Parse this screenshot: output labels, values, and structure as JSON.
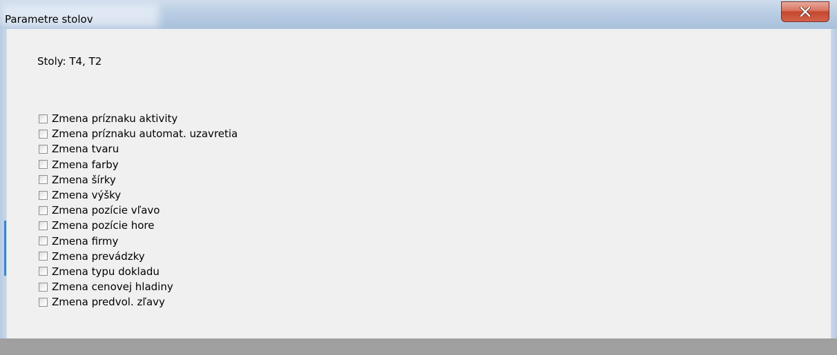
{
  "window": {
    "title": "Parametre stolov"
  },
  "content": {
    "stoly_text": "Stoly: T4, T2"
  },
  "checklist": [
    {
      "label": "Zmena príznaku aktivity",
      "checked": false
    },
    {
      "label": "Zmena príznaku automat. uzavretia",
      "checked": false
    },
    {
      "label": "Zmena tvaru",
      "checked": false
    },
    {
      "label": "Zmena farby",
      "checked": false
    },
    {
      "label": "Zmena šírky",
      "checked": false
    },
    {
      "label": "Zmena výšky",
      "checked": false
    },
    {
      "label": "Zmena pozície vľavo",
      "checked": false
    },
    {
      "label": "Zmena pozície hore",
      "checked": false
    },
    {
      "label": "Zmena firmy",
      "checked": false
    },
    {
      "label": "Zmena prevádzky",
      "checked": false
    },
    {
      "label": "Zmena typu dokladu",
      "checked": false
    },
    {
      "label": "Zmena cenovej hladiny",
      "checked": false
    },
    {
      "label": "Zmena predvol. zľavy",
      "checked": false
    }
  ],
  "colors": {
    "close_button": "#c4472e",
    "titlebar": "#b9cde4",
    "background": "#f0f0f0"
  },
  "icons": {
    "close": "close-icon"
  }
}
